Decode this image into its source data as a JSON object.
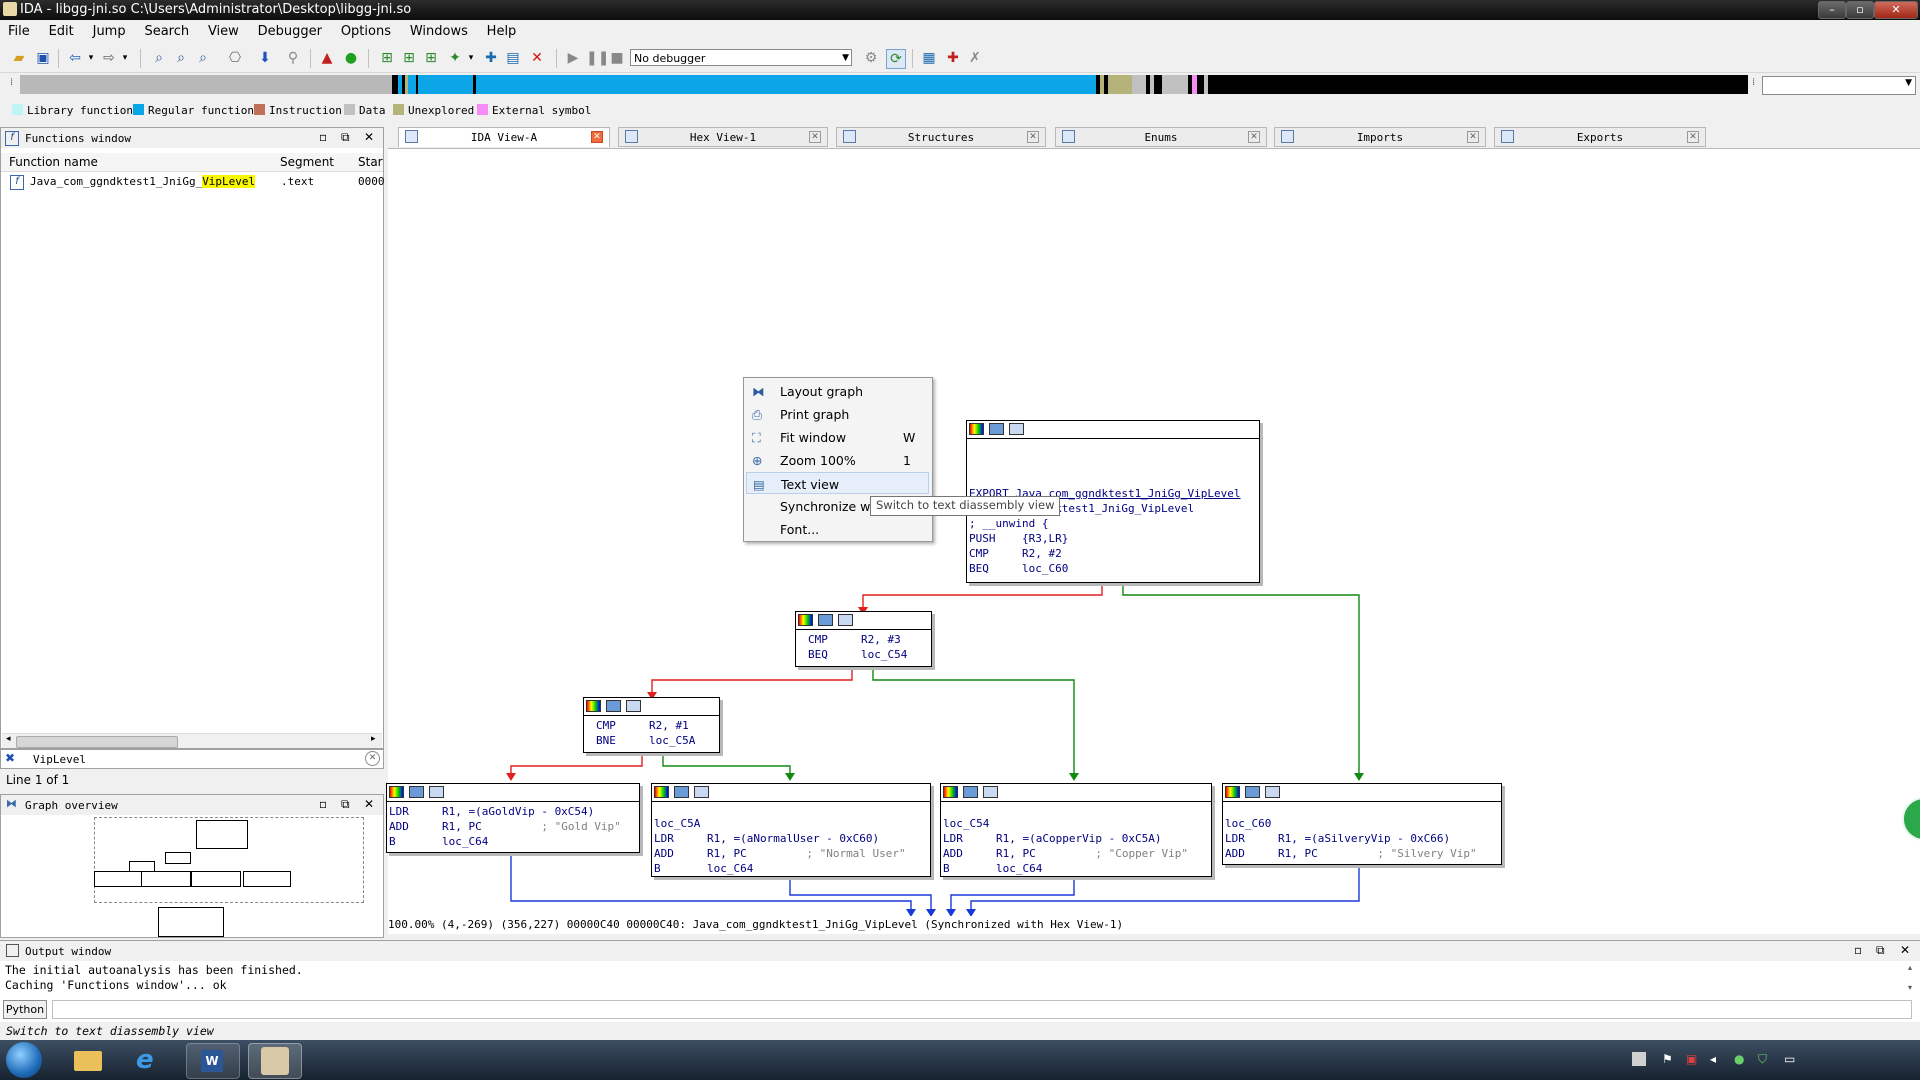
{
  "window": {
    "title": "IDA - libgg-jni.so C:\\Users\\Administrator\\Desktop\\libgg-jni.so"
  },
  "menu": [
    "File",
    "Edit",
    "Jump",
    "Search",
    "View",
    "Debugger",
    "Options",
    "Windows",
    "Help"
  ],
  "toolbar": {
    "debugger": "No debugger"
  },
  "legend": [
    {
      "label": "Library function",
      "color": "#bff4f4"
    },
    {
      "label": "Regular function",
      "color": "#0ca6e8"
    },
    {
      "label": "Instruction",
      "color": "#c07058"
    },
    {
      "label": "Data",
      "color": "#c0c0c0"
    },
    {
      "label": "Unexplored",
      "color": "#b4b47a"
    },
    {
      "label": "External symbol",
      "color": "#f58cf5"
    }
  ],
  "functions_window": {
    "title": "Functions window",
    "columns": [
      "Function name",
      "Segment",
      "Star"
    ],
    "rows": [
      {
        "name_prefix": "Java_com_ggndktest1_JniGg_",
        "name_match": "VipLevel",
        "segment": ".text",
        "start": "0000"
      }
    ],
    "filter": "VipLevel",
    "line_count": "Line 1 of 1"
  },
  "graph_overview": {
    "title": "Graph overview"
  },
  "tabs": [
    {
      "label": "IDA View-A",
      "active": true
    },
    {
      "label": "Hex View-1"
    },
    {
      "label": "Structures"
    },
    {
      "label": "Enums"
    },
    {
      "label": "Imports"
    },
    {
      "label": "Exports"
    }
  ],
  "graph": {
    "nodes": {
      "entry": {
        "l1": "EXPORT Java_com_ggndktest1_JniGg_VipLevel",
        "l2": "Java_com_ggndktest1_JniGg_VipLevel",
        "l3": "; __unwind {",
        "l4": "PUSH    {R3,LR}",
        "l5": "CMP     R2, #2",
        "l6": "BEQ     loc_C60"
      },
      "n2": {
        "l1": "CMP     R2, #3",
        "l2": "BEQ     loc_C54"
      },
      "n3": {
        "l1": "CMP     R2, #1",
        "l2": "BNE     loc_C5A"
      },
      "gold": {
        "l1": "LDR     R1, =(aGoldVip - 0xC54)",
        "l2": "ADD     R1, PC",
        "l2c": "; \"Gold Vip\"",
        "l3": "B       loc_C64"
      },
      "c5a": {
        "l0": "loc_C5A",
        "l1": "LDR     R1, =(aNormalUser - 0xC60)",
        "l2": "ADD     R1, PC",
        "l2c": "; \"Normal User\"",
        "l3": "B       loc_C64"
      },
      "c54": {
        "l0": "loc_C54",
        "l1": "LDR     R1, =(aCopperVip - 0xC5A)",
        "l2": "ADD     R1, PC",
        "l2c": "; \"Copper Vip\"",
        "l3": "B       loc_C64"
      },
      "c60": {
        "l0": "loc_C60",
        "l1": "LDR     R1, =(aSilveryVip - 0xC66)",
        "l2": "ADD     R1, PC",
        "l2c": "; \"Silvery Vip\""
      }
    },
    "status": "100.00% (4,-269) (356,227) 00000C40 00000C40: Java_com_ggndktest1_JniGg_VipLevel (Synchronized with Hex View-1)"
  },
  "context_menu": {
    "items": [
      {
        "label": "Layout graph",
        "key": ""
      },
      {
        "label": "Print graph",
        "key": ""
      },
      {
        "label": "Fit window",
        "key": "W"
      },
      {
        "label": "Zoom 100%",
        "key": "1"
      },
      {
        "label": "Text view",
        "key": ""
      },
      {
        "label": "Synchronize wit",
        "key": ""
      },
      {
        "label": "Font...",
        "key": ""
      }
    ],
    "tooltip": "Switch to text diassembly view"
  },
  "output": {
    "title": "Output window",
    "lines": "The initial autoanalysis has been finished.\nCaching 'Functions window'... ok",
    "python_label": "Python"
  },
  "statusbar": {
    "text": "Switch to text diassembly view"
  }
}
